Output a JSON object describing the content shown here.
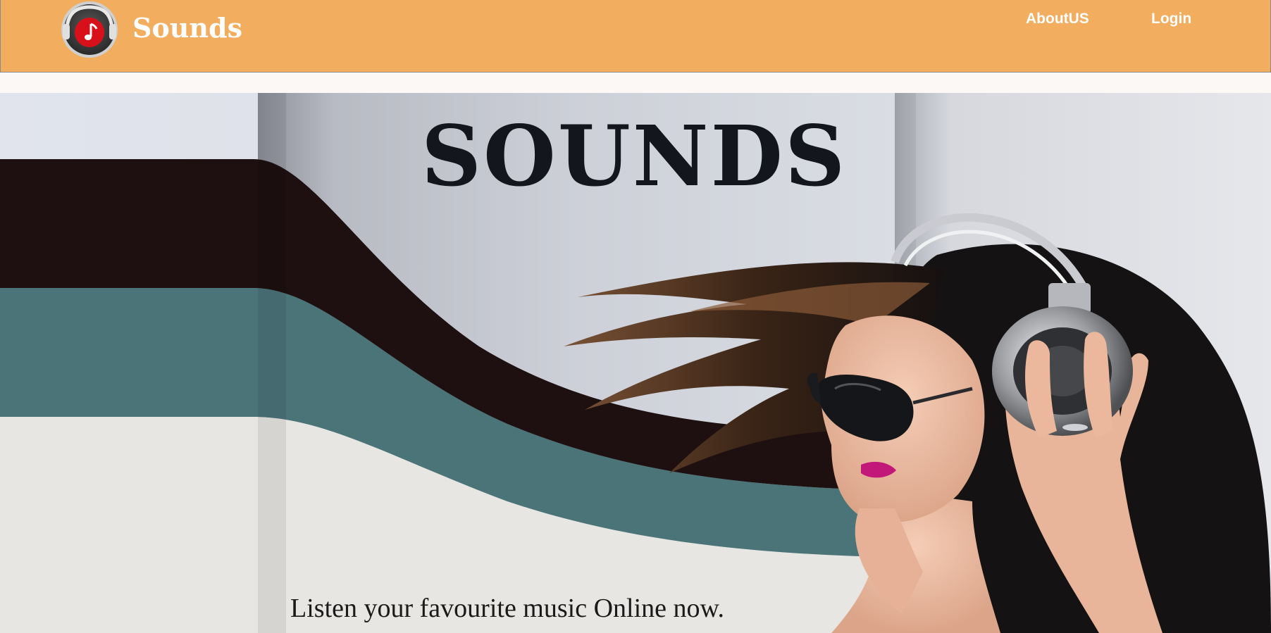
{
  "header": {
    "brand": "Sounds",
    "nav": [
      {
        "label": "AboutUS"
      },
      {
        "label": "Login"
      }
    ],
    "logo_icon": "headphones-music-note-icon",
    "colors": {
      "header_bg": "#f2ad5f",
      "logo_red": "#d8101a"
    }
  },
  "hero": {
    "title": "SOUNDS",
    "tagline": "Listen your favourite music Online now.",
    "image": "woman-with-headphones-and-sunglasses"
  }
}
